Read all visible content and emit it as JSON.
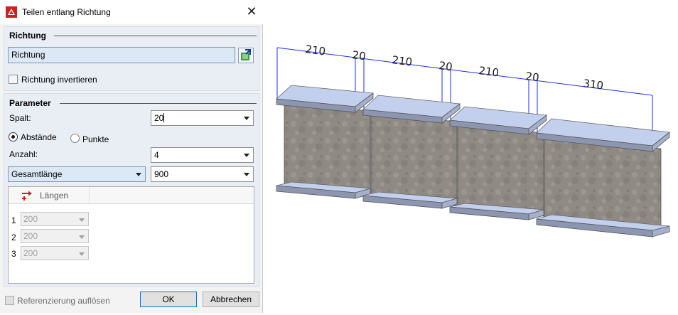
{
  "window": {
    "title": "Teilen entlang Richtung"
  },
  "icons": {
    "app": "hicad-logo-icon",
    "close": "close-icon",
    "pick": "pick-direction-icon",
    "lengths": "lengths-icon"
  },
  "richtung": {
    "section_title": "Richtung",
    "field_value": "Richtung",
    "invert_label": "Richtung invertieren",
    "invert_checked": false
  },
  "parameter": {
    "section_title": "Parameter",
    "spalt_label": "Spalt:",
    "spalt_value": "20",
    "radio_distances": "Abstände",
    "radio_points": "Punkte",
    "selected_mode": "Abstände",
    "anzahl_label": "Anzahl:",
    "anzahl_value": "4",
    "mode_select": "Gesamtlänge",
    "total_value": "900"
  },
  "lengths_table": {
    "header": "Längen",
    "rows": [
      {
        "num": "1",
        "value": "200"
      },
      {
        "num": "2",
        "value": "200"
      },
      {
        "num": "3",
        "value": "200"
      }
    ]
  },
  "footer": {
    "reference_label": "Referenzierung auflösen",
    "ok": "OK",
    "cancel": "Abbrechen"
  },
  "dimensions": [
    "210",
    "20",
    "210",
    "20",
    "210",
    "20",
    "310"
  ],
  "colors": {
    "accent": "#0078d7",
    "flange": "#b9c8ea",
    "web": "#8e8984",
    "dimension_line": "#1f2ee8"
  }
}
